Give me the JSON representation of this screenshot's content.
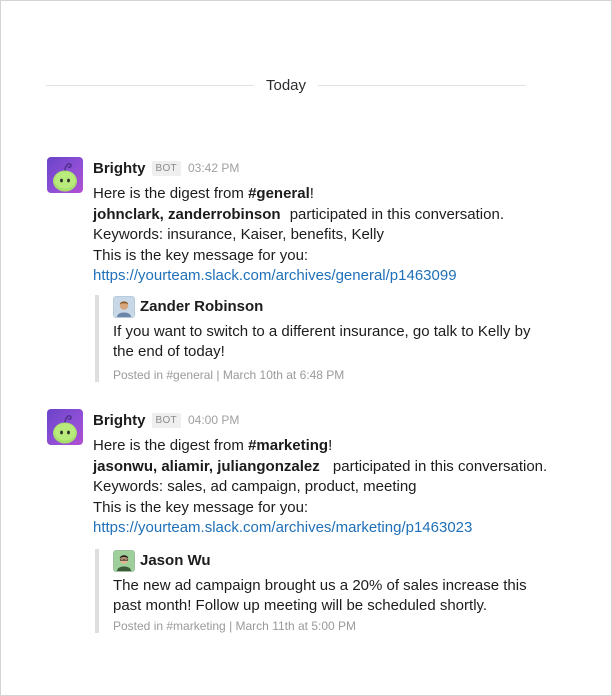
{
  "divider": {
    "label": "Today"
  },
  "colors": {
    "link": "#1f70b8",
    "bot_avatar": "#7b48d1",
    "muted": "#a0a0a2"
  },
  "messages": [
    {
      "sender": "Brighty",
      "badge": "BOT",
      "time": "03:42 PM",
      "intro": "Here is the digest from ",
      "channel": "#general",
      "intro_end": "!",
      "participants": "johnclark, zanderrobinson",
      "participated": "participated in this conversation.",
      "keywords": "Keywords: insurance, Kaiser, benefits, Kelly",
      "key_intro": "This is the key message for you:",
      "link": "https://yourteam.slack.com/archives/general/p1463099",
      "quote": {
        "author": "Zander Robinson",
        "text": "If you want to switch to a different insurance, go talk to Kelly by the end of today!",
        "footer": "Posted in #general | March 10th at 6:48 PM"
      }
    },
    {
      "sender": "Brighty",
      "badge": "BOT",
      "time": "04:00 PM",
      "intro": "Here is the digest from ",
      "channel": "#marketing",
      "intro_end": "!",
      "participants": "jasonwu, aliamir, juliangonzalez",
      "participated": "participated in this conversation.",
      "keywords": "Keywords: sales, ad campaign, product, meeting",
      "key_intro": "This is the key message for you:",
      "link": "https://yourteam.slack.com/archives/marketing/p1463023",
      "quote": {
        "author": "Jason Wu",
        "text": "The new ad campaign brought us a 20% of sales increase this past month! Follow up meeting will be scheduled shortly.",
        "footer": "Posted in #marketing | March 11th at 5:00 PM"
      }
    }
  ]
}
